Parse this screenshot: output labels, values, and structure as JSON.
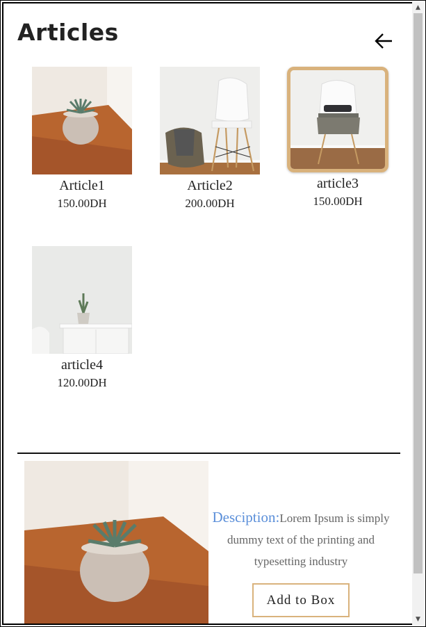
{
  "page": {
    "title": "Articles"
  },
  "articles": [
    {
      "name": "Article1",
      "price": "150.00DH"
    },
    {
      "name": "Article2",
      "price": "200.00DH"
    },
    {
      "name": "article3",
      "price": "150.00DH"
    },
    {
      "name": "article4",
      "price": "120.00DH"
    }
  ],
  "detail": {
    "label": "Desciption:",
    "text": "Lorem Ipsum is simply dummy text of the printing and typesetting industry",
    "button_label": "Add to Box"
  },
  "icons": {
    "back": "arrow-left-icon"
  },
  "colors": {
    "accent_border": "#d9b27c",
    "label_blue": "#5b8fd9"
  }
}
